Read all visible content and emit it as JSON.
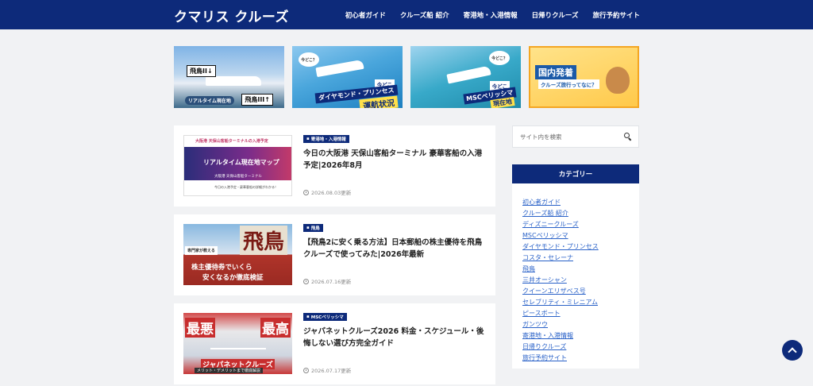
{
  "site": {
    "logo": "クマリス クルーズ",
    "colors": {
      "brand": "#0d2a7a",
      "link": "#2a62c8",
      "background": "#f1f2f4"
    }
  },
  "nav": {
    "items": [
      "初心者ガイド",
      "クルーズ船 紹介",
      "寄港地・入港情報",
      "日帰りクルーズ",
      "旅行予約サイト"
    ]
  },
  "banners": [
    {
      "lines": [
        "飛鳥II↓",
        "飛鳥III↑",
        "リアルタイム現在地"
      ]
    },
    {
      "bubble": "今どこ？",
      "lines": [
        "今どこ",
        "ダイヤモンド・プリンセス",
        "運航状況"
      ]
    },
    {
      "bubble": "今どこ？",
      "lines": [
        "今どこ",
        "MSCベリッシマ",
        "現在地"
      ]
    },
    {
      "lines": [
        "国内発着",
        "クルーズ旅行ってなに？"
      ]
    }
  ],
  "articles": [
    {
      "category": "寄港地・入港情報",
      "title": "今日の大阪港 天保山客船ターミナル 豪華客船の入港予定|2026年8月",
      "date": "2026.08.03更新",
      "thumb": {
        "top": "大阪港 天保山客船ターミナルの入港予定",
        "main": "リアルタイム現在地マップ",
        "sub": "大阪港 天保山客船ターミナル",
        "foot": "今日の入港予定・豪華客船の詳細がわかる！"
      }
    },
    {
      "category": "飛鳥",
      "title": "【飛鳥2に安く乗る方法】日本郵船の株主優待を飛鳥クルーズで使ってみた|2026年最新",
      "date": "2026.07.16更新",
      "thumb": {
        "big": "飛鳥",
        "pill": "専門家が教える",
        "l1": "株主優待券でいくら",
        "l2": "安くなるか徹底検証"
      }
    },
    {
      "category": "MSCベリッシマ",
      "title": "ジャパネットクルーズ2026 料金・スケジュール・後悔しない選び方完全ガイド",
      "date": "2026.07.17更新",
      "thumb": {
        "left": "最悪",
        "right": "最高",
        "l1": "ジャパネットクルーズ",
        "l2": "メリット・デメリットまで徹底解説"
      }
    }
  ],
  "sidebar": {
    "search_placeholder": "サイト内を検索",
    "categories_title": "カテゴリー",
    "categories": [
      "初心者ガイド",
      "クルーズ船 紹介",
      "ディズニークルーズ",
      "MSCベリッシマ",
      "ダイヤモンド・プリンセス",
      "コスタ・セレーナ",
      "飛鳥",
      "三井オーシャン",
      "クイーンエリザベス号",
      "セレブリティ・ミレニアム",
      "ピースボート",
      "ガンツウ",
      "寄港地・入港情報",
      "日帰りクルーズ",
      "旅行予約サイト"
    ]
  },
  "icons": {
    "search": "search-icon",
    "clock": "clock-icon",
    "folder": "folder-icon",
    "scroll_top": "chevron-up-icon"
  }
}
